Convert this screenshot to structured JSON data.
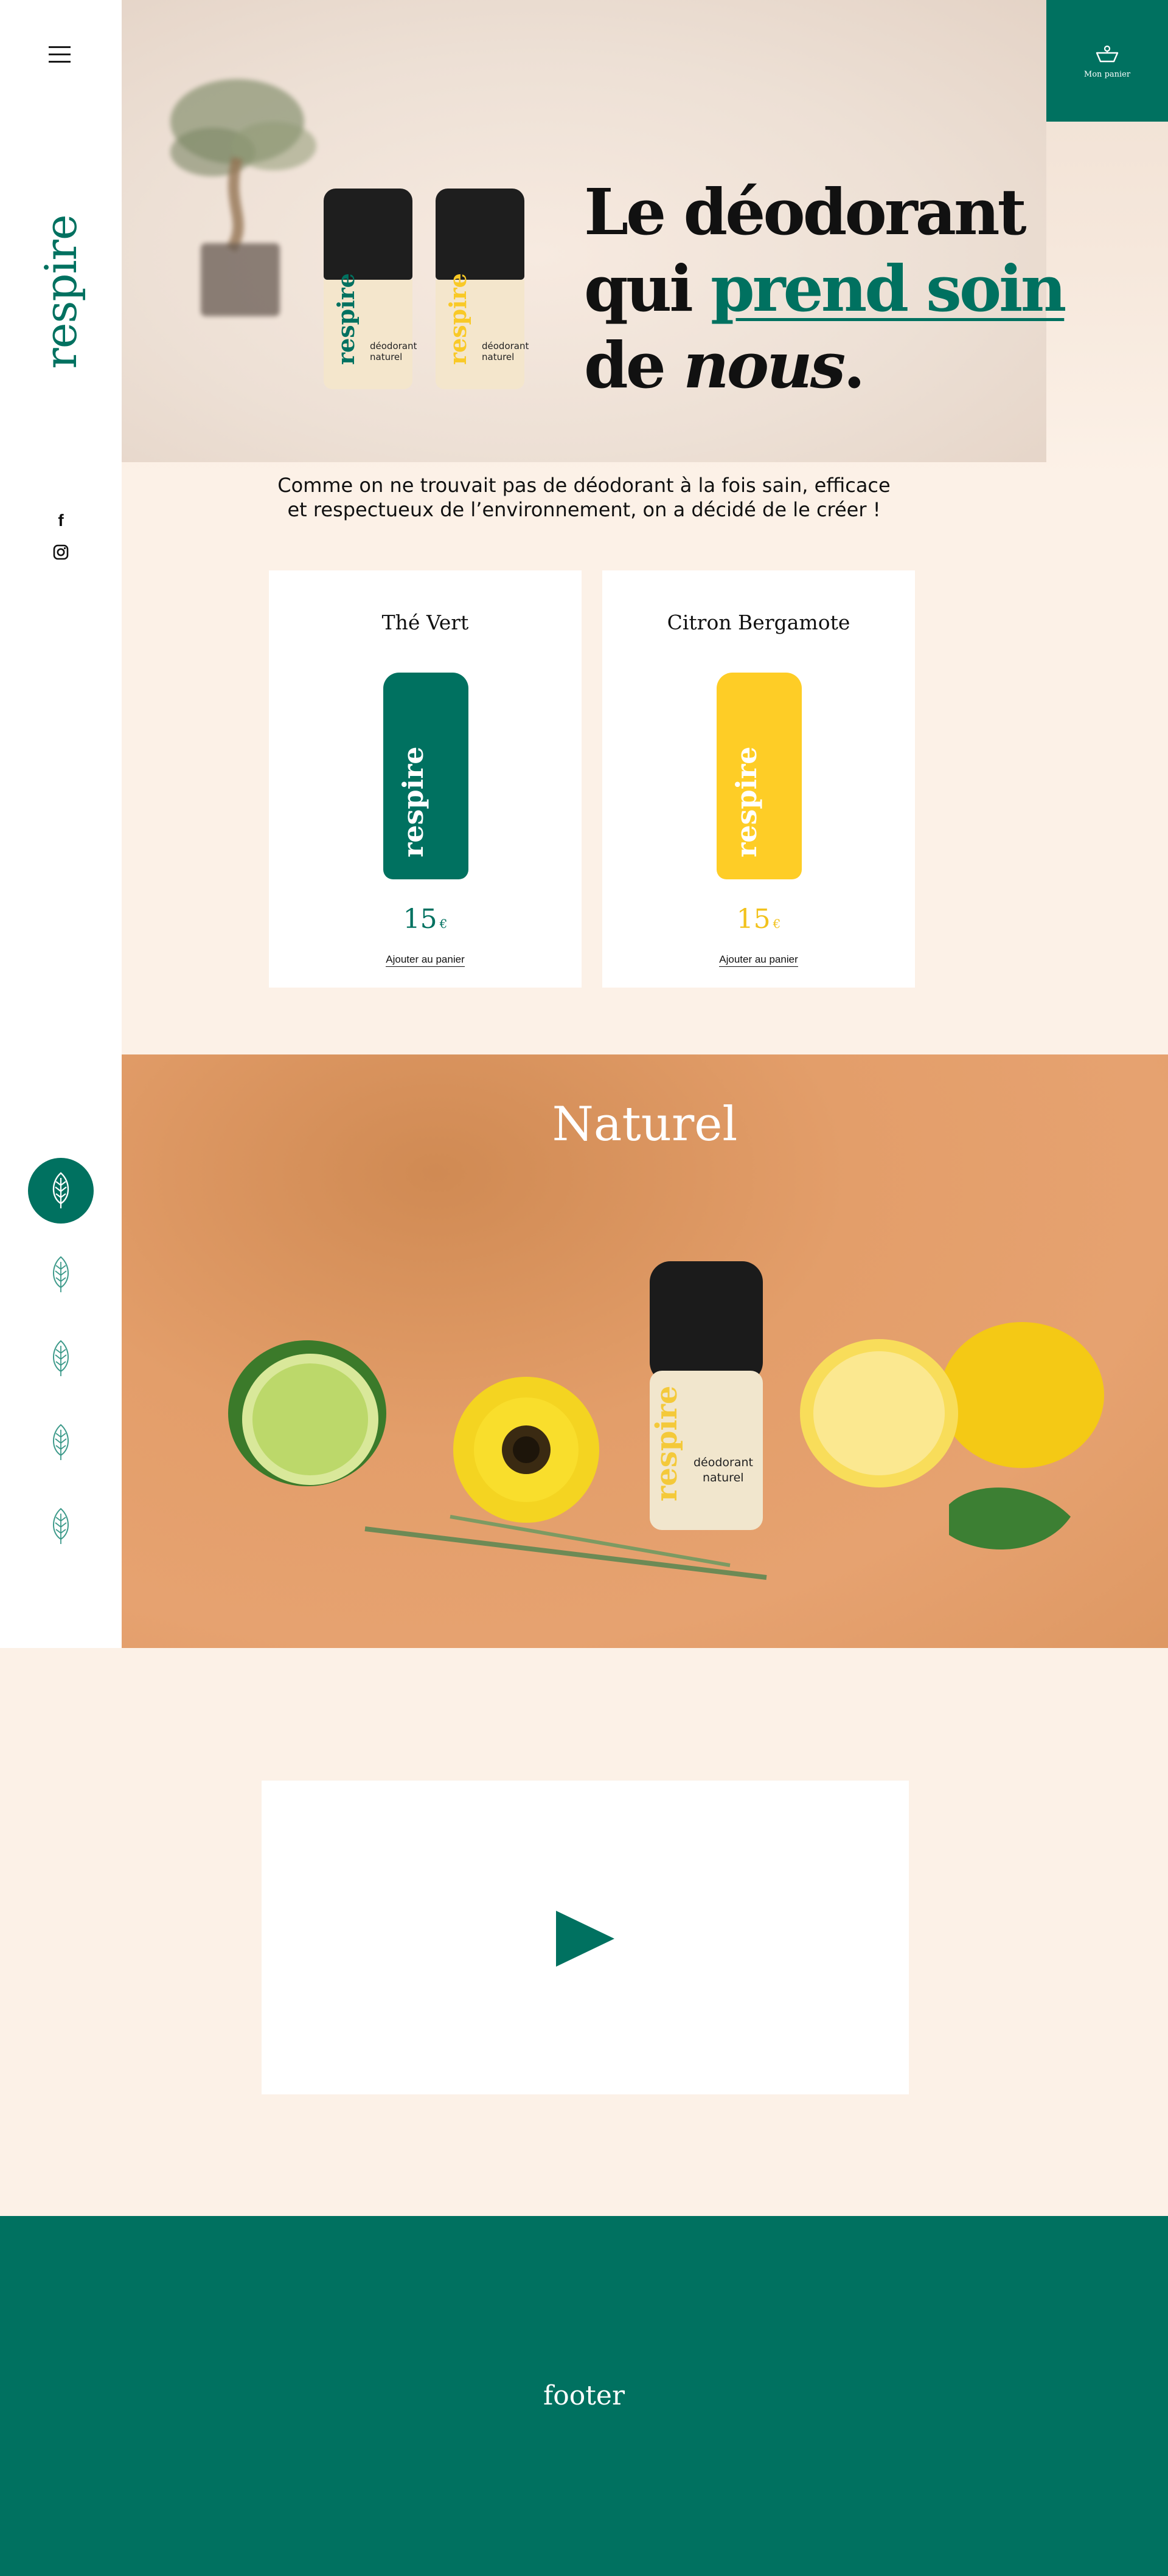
{
  "sidebar": {
    "brand": "respire",
    "menu_icon": "hamburger-menu-icon",
    "social": [
      {
        "name": "facebook",
        "icon": "facebook-icon",
        "glyph": "f"
      },
      {
        "name": "instagram",
        "icon": "instagram-icon"
      }
    ],
    "section_nav": [
      {
        "icon": "leaf-icon",
        "active": true
      },
      {
        "icon": "leaf-icon",
        "active": false
      },
      {
        "icon": "leaf-icon",
        "active": false
      },
      {
        "icon": "leaf-icon",
        "active": false
      },
      {
        "icon": "leaf-icon",
        "active": false
      }
    ]
  },
  "cart": {
    "label": "Mon panier",
    "icon": "cart-icon"
  },
  "hero": {
    "headline_line1": "Le déodorant",
    "headline_line2_a": "qui ",
    "headline_line2_accent": "prend soin",
    "headline_line3_a": "de ",
    "headline_line3_em": "nous",
    "headline_line3_b": ".",
    "jars": [
      {
        "logo": "respire",
        "line1": "déodorant",
        "line2": "naturel",
        "color": "#007160"
      },
      {
        "logo": "respire",
        "line1": "déodorant",
        "line2": "naturel",
        "color": "#f9c926"
      }
    ]
  },
  "intro": {
    "line1": "Comme on ne trouvait pas de déodorant à la fois sain, efficace",
    "line2": "et respectueux de l’environnement, on a décidé de le créer !"
  },
  "products": [
    {
      "name": "Thé Vert",
      "brand": "respire",
      "price": "15",
      "currency": "€",
      "cta": "Ajouter au panier",
      "color": "#007160"
    },
    {
      "name": "Citron Bergamote",
      "brand": "respire",
      "price": "15",
      "currency": "€",
      "cta": "Ajouter au panier",
      "color": "#fecd26"
    }
  ],
  "naturel": {
    "title": "Naturel",
    "jar": {
      "logo": "respire",
      "line1": "déodorant",
      "line2": "naturel"
    }
  },
  "video": {
    "icon": "play-icon"
  },
  "footer": {
    "text": "footer"
  },
  "colors": {
    "accent": "#007160",
    "yellow": "#fecd26",
    "cream": "#fcf1e7"
  }
}
